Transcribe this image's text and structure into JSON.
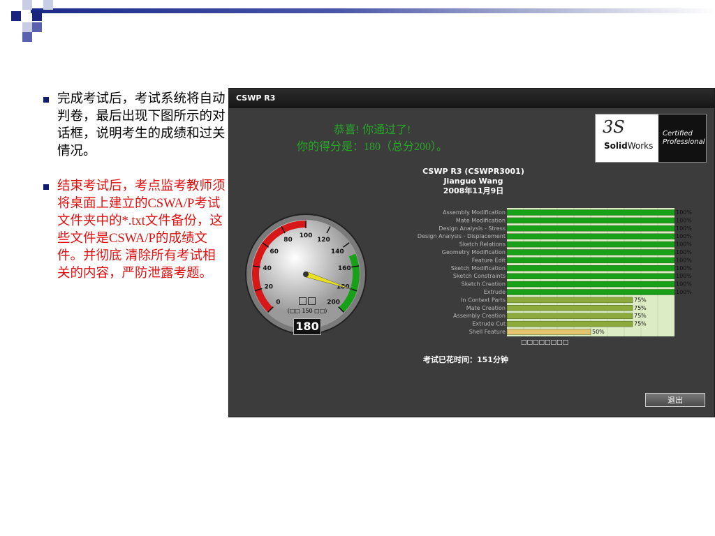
{
  "bullets": [
    {
      "text": "完成考试后，考试系统将自动判卷，最后出现下图所示的对话框，说明考生的成绩和过关情况。"
    },
    {
      "text": "结束考试后，考点监考教师须将桌面上建立的CSWA/P考试文件夹中的*.txt文件备份，这些文件是CSWA/P的成绩文件。并彻底 清除所有考试相 关的内容，严防泄露考题。"
    }
  ],
  "dialog": {
    "title": "CSWP R3",
    "congrats_line1": "恭喜! 你通过了!",
    "congrats_line2": "你的得分是：180（总分200）。",
    "logo": {
      "ds": "3S",
      "solid": "Solid",
      "works": "Works",
      "certified": "Certified",
      "professional": "Professional"
    },
    "exam_title": "CSWP R3 (CSWPR3001)",
    "candidate": "Jianguo Wang",
    "date": "2008年11月9日",
    "gauge": {
      "label": "□□",
      "sub": "(□□ 150 □□)",
      "value": "180",
      "ticks": [
        "0",
        "20",
        "40",
        "60",
        "80",
        "100",
        "120",
        "140",
        "160",
        "180",
        "200"
      ]
    },
    "legend": "□□□□□□□□",
    "elapsed": "考试已花时间：151分钟",
    "exit_label": "退出"
  },
  "chart_data": {
    "type": "bar",
    "categories": [
      "Assembly Modification",
      "Mate Modification",
      "Design Analysis - Stress",
      "Design Analysis - Displacement",
      "Sketch Relations",
      "Geometry Modification",
      "Feature Edit",
      "Sketch Modification",
      "Sketch Constraints",
      "Sketch Creation",
      "Extrude",
      "In Context Parts",
      "Mate Creation",
      "Assembly Creation",
      "Extrude Cut",
      "Shell Feature"
    ],
    "values": [
      100,
      100,
      100,
      100,
      100,
      100,
      100,
      100,
      100,
      100,
      100,
      75,
      75,
      75,
      75,
      50
    ],
    "value_labels": [
      "100%",
      "100%",
      "100%",
      "100%",
      "100%",
      "100%",
      "100%",
      "100%",
      "100%",
      "100%",
      "100%",
      "75%",
      "75%",
      "75%",
      "75%",
      "50%"
    ],
    "xlim": [
      0,
      100
    ],
    "colors": {
      "full": "#18a018",
      "partial": "#8cab3c",
      "half": "#e4c270",
      "bg": "#dcecc4"
    }
  }
}
